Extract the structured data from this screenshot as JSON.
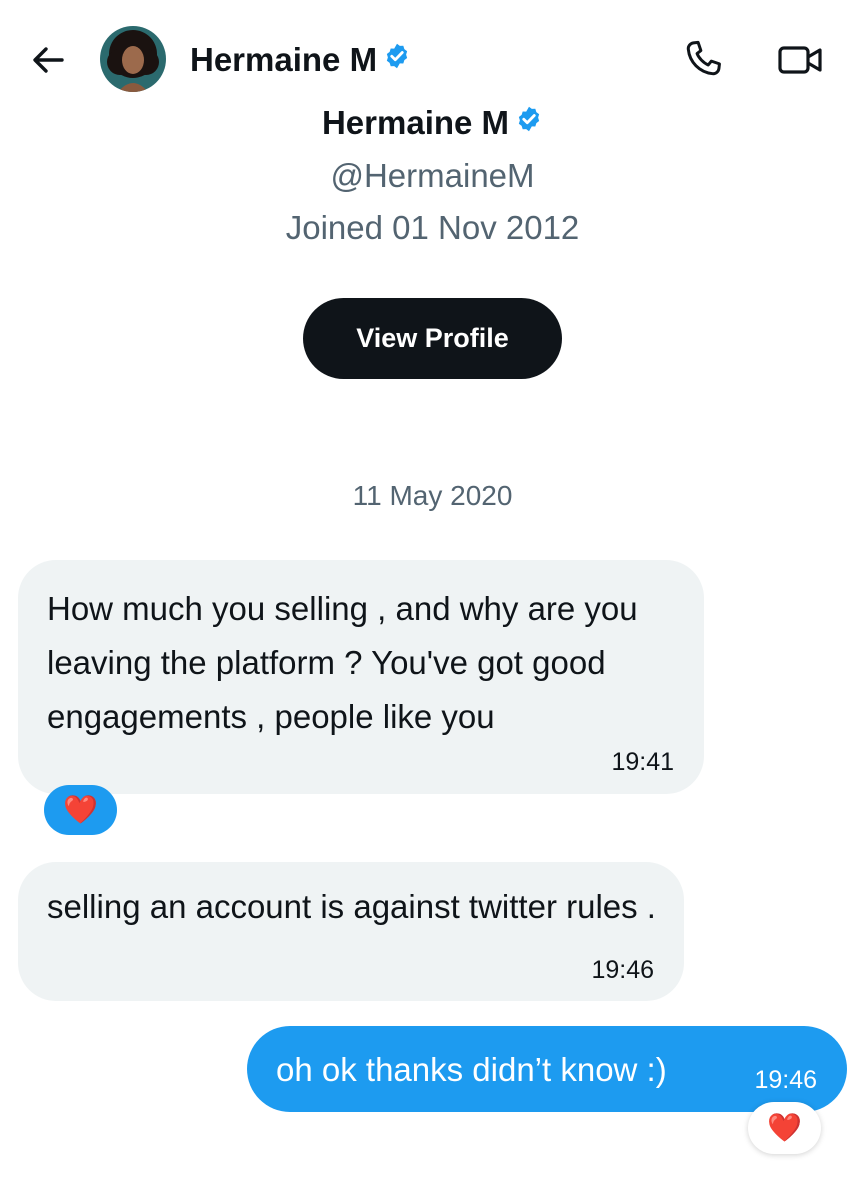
{
  "header": {
    "name": "Hermaine M",
    "verified_icon": "verified-badge-icon",
    "back_icon": "arrow-left-icon",
    "call_icon": "phone-icon",
    "video_icon": "video-camera-icon"
  },
  "profile": {
    "name": "Hermaine M",
    "handle": "@HermaineM",
    "joined": "Joined 01 Nov 2012",
    "view_profile_label": "View Profile"
  },
  "conversation": {
    "date": "11 May 2020",
    "messages": [
      {
        "direction": "incoming",
        "text": "How much you selling , and why are you leaving the platform ? You've got good engagements , people like you",
        "time": "19:41",
        "reaction": "❤️"
      },
      {
        "direction": "incoming",
        "text": "selling an account is against twitter rules .",
        "time": "19:46"
      },
      {
        "direction": "outgoing",
        "text": "oh ok thanks didn’t know :)",
        "time": "19:46",
        "reaction": "❤️"
      }
    ]
  },
  "colors": {
    "accent": "#1d9bf0",
    "incoming_bubble": "#eff3f4",
    "text": "#0f1419",
    "secondary_text": "#536471",
    "button_bg": "#0f1419"
  }
}
